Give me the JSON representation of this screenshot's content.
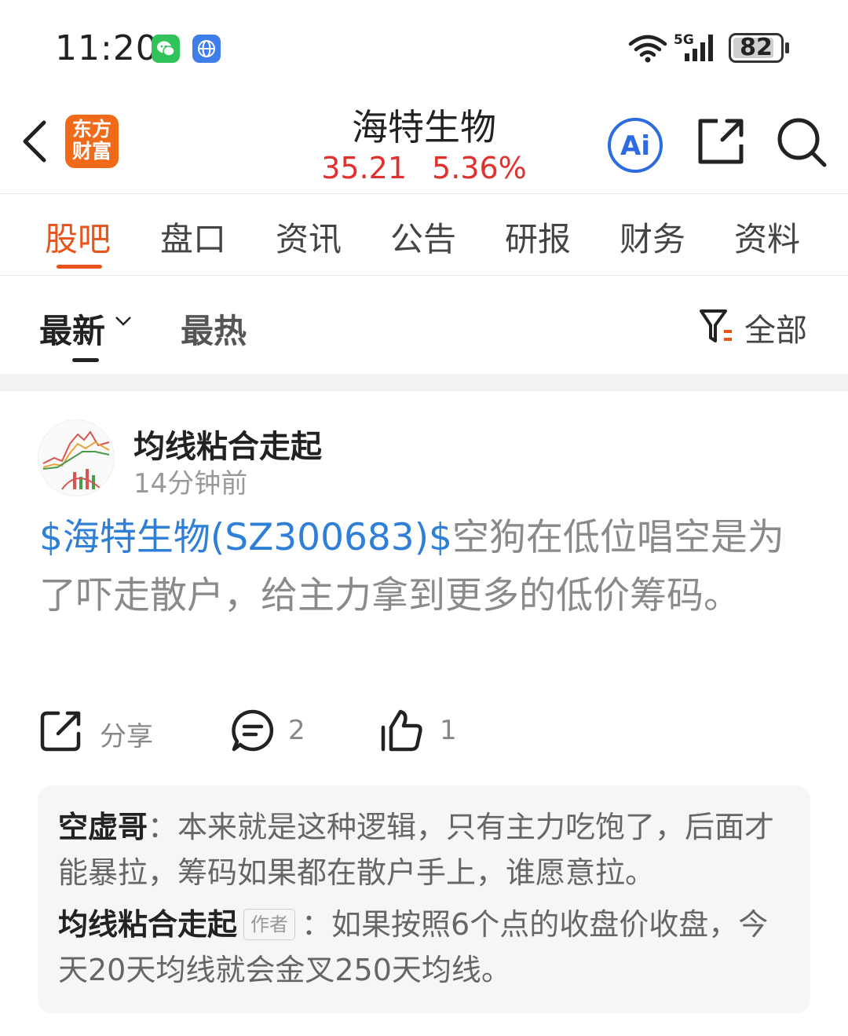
{
  "status_bar": {
    "time": "11:20",
    "network": "5G",
    "battery": "82"
  },
  "header": {
    "logo_line1": "东方",
    "logo_line2": "财富",
    "title": "海特生物",
    "price": "35.21",
    "change": "5.36%",
    "ai_label": "Ai"
  },
  "tabs": [
    "股吧",
    "盘口",
    "资讯",
    "公告",
    "研报",
    "财务",
    "资料"
  ],
  "filter": {
    "latest": "最新",
    "hot": "最热",
    "all": "全部"
  },
  "post": {
    "author": "均线粘合走起",
    "time": "14分钟前",
    "stock_link": "$海特生物(SZ300683)$",
    "text": "空狗在低位唱空是为了吓走散户，给主力拿到更多的低价筹码。",
    "share_label": "分享",
    "comment_count": "2",
    "like_count": "1"
  },
  "comments": [
    {
      "name": "空虚哥",
      "sep": "：",
      "text": "本来就是这种逻辑，只有主力吃饱了，后面才能暴拉，筹码如果都在散户手上，谁愿意拉。"
    },
    {
      "name": "均线粘合走起",
      "tag": "作者",
      "sep": "：",
      "text": "如果按照6个点的收盘价收盘，今天20天均线就会金叉250天均线。"
    }
  ],
  "colors": {
    "accent": "#e8531a",
    "price_red": "#e0312f",
    "link_blue": "#2f7fd6"
  }
}
